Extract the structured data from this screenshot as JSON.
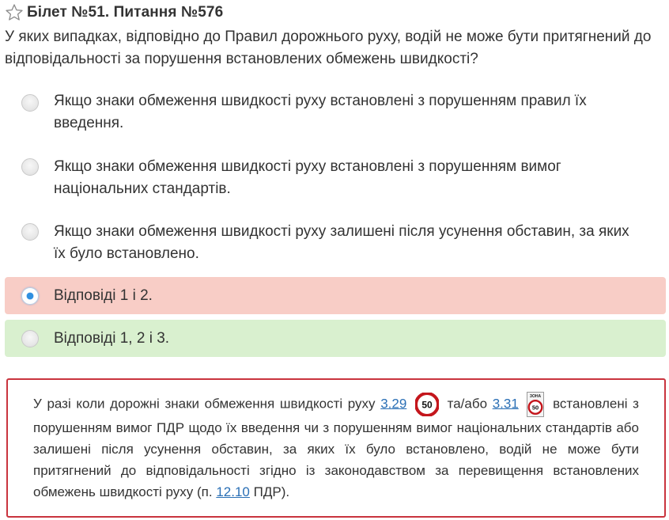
{
  "header": {
    "star_icon": "star-outline-icon",
    "title": "Білет №51. Питання №576"
  },
  "question": {
    "text": "У яких випадках, відповідно до Правил дорожнього руху, водій не може бути притягнений до відповідальності за порушення встановлених обмежень швидкості?"
  },
  "answers": [
    {
      "label": "Якщо знаки обмеження швидкості руху встановлені з порушенням правил їх введення.",
      "selected": false,
      "status": "neutral"
    },
    {
      "label": "Якщо знаки обмеження швидкості руху встановлені з порушенням вимог національних стандартів.",
      "selected": false,
      "status": "neutral"
    },
    {
      "label": "Якщо знаки обмеження швидкості руху залишені після усунення обставин, за яких їх було встановлено.",
      "selected": false,
      "status": "neutral"
    },
    {
      "label": "Відповіді 1 і 2.",
      "selected": true,
      "status": "wrong"
    },
    {
      "label": "Відповіді 1, 2 і 3.",
      "selected": false,
      "status": "correct"
    }
  ],
  "explanation": {
    "part1": "У разі коли дорожні знаки обмеження швидкості руху",
    "link1": "3.29",
    "sign1_value": "50",
    "part2": "та/або",
    "link2": "3.31",
    "sign2_top": "ЗОНА",
    "sign2_value": "50",
    "part3": "встановлені з порушенням вимог ПДР щодо їх введення чи з порушенням вимог національних стандартів або залишені після усунення обставин, за яких їх було встановлено, водій не може бути притягнений до відповідальності згідно із законодавством за перевищення встановлених обмежень швидкості руху (п.",
    "link3": "12.10",
    "part4": "ПДР)."
  },
  "colors": {
    "wrong_bg": "#f8cdc6",
    "correct_bg": "#d9f0cf",
    "explanation_border": "#c9343e",
    "link": "#2a6fb5"
  }
}
